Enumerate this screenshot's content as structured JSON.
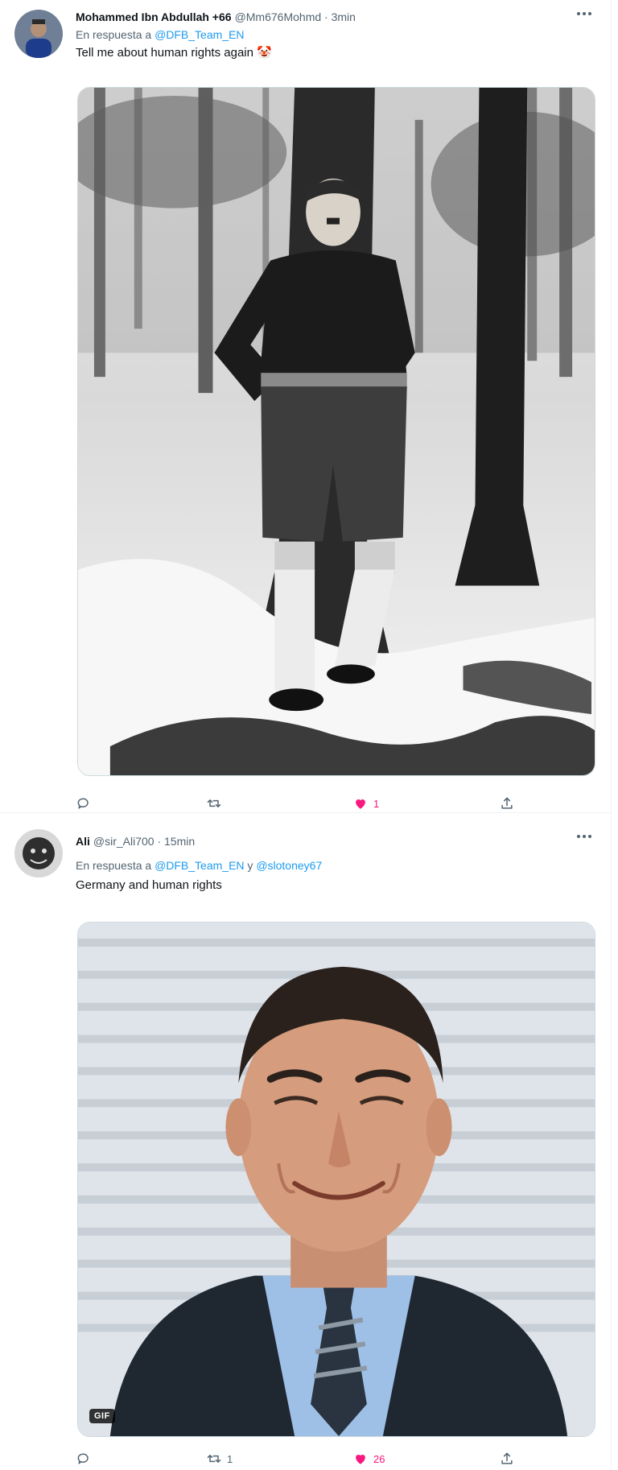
{
  "tweets": [
    {
      "author_name": "Mohammed Ibn Abdullah +66",
      "handle_time": "@Mm676Mohmd · 3min",
      "reply_prefix": "En respuesta a",
      "mentions": [
        "@DFB_Team_EN"
      ],
      "text": "Tell me about human rights again",
      "emoji": "🤡",
      "counts": {
        "reply": "",
        "retweet": "",
        "like": "1",
        "share": ""
      },
      "like_color": "#f91880"
    },
    {
      "author_name": "Ali",
      "handle_time": "@sir_Ali700 · 15min",
      "reply_prefix": "En respuesta a",
      "mentions": [
        "@DFB_Team_EN",
        "@slotoney67"
      ],
      "mention_joiner": "y",
      "text": "Germany and human rights",
      "media_badge": "GIF",
      "counts": {
        "reply": "",
        "retweet": "1",
        "like": "26",
        "share": ""
      },
      "like_color": "#f91880"
    }
  ],
  "icons": {
    "more": "more-dots-icon",
    "reply": "reply-bubble-icon",
    "retweet": "retweet-icon",
    "like": "heart-icon",
    "share": "share-icon"
  },
  "colors": {
    "accent": "#1d9bf0",
    "secondary_text": "#536471",
    "like": "#f91880"
  }
}
